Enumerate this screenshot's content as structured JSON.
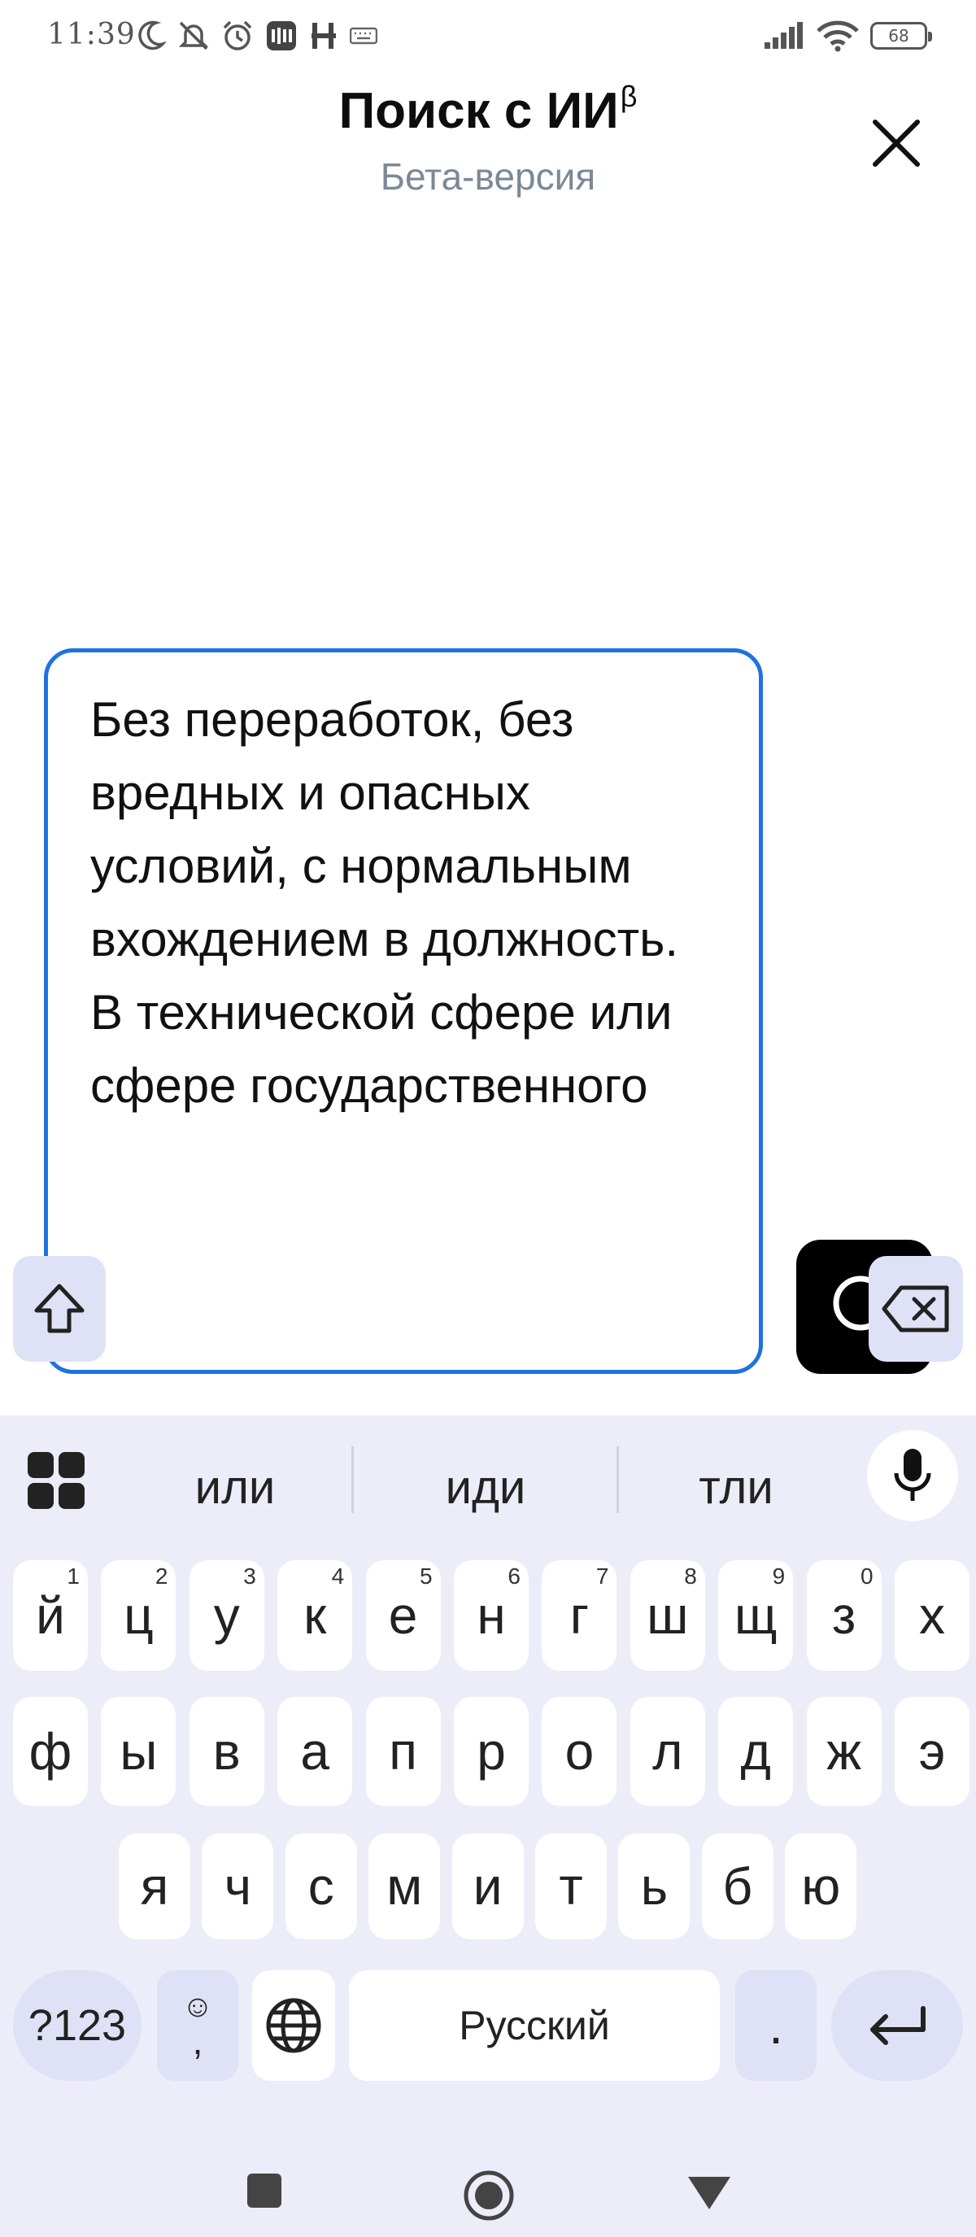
{
  "status_bar": {
    "time": "11:39",
    "battery": "68",
    "left_icons": [
      "moon-icon",
      "bell-off-icon",
      "alarm-icon",
      "app-notification-icon",
      "app-h-icon",
      "keyboard-icon"
    ],
    "right_icons": [
      "signal-icon",
      "wifi-icon",
      "battery-icon"
    ]
  },
  "header": {
    "title": "Поиск с ИИ",
    "title_superscript": "β",
    "subtitle": "Бета-версия",
    "close_icon": "close-icon"
  },
  "query": {
    "value": "Без переработок, без вредных и опасных условий, с нормальным вхождением в должность. В технической сфере или сфере государственного",
    "border_color": "#1f72e0"
  },
  "search_button": {
    "icon": "search-icon",
    "background": "#000000"
  },
  "keyboard": {
    "suggestions": [
      "или",
      "иди",
      "тли"
    ],
    "row1": [
      {
        "label": "й",
        "hint": "1"
      },
      {
        "label": "ц",
        "hint": "2"
      },
      {
        "label": "у",
        "hint": "3"
      },
      {
        "label": "к",
        "hint": "4"
      },
      {
        "label": "е",
        "hint": "5"
      },
      {
        "label": "н",
        "hint": "6"
      },
      {
        "label": "г",
        "hint": "7"
      },
      {
        "label": "ш",
        "hint": "8"
      },
      {
        "label": "щ",
        "hint": "9"
      },
      {
        "label": "з",
        "hint": "0"
      },
      {
        "label": "х",
        "hint": ""
      }
    ],
    "row2": [
      "ф",
      "ы",
      "в",
      "а",
      "п",
      "р",
      "о",
      "л",
      "д",
      "ж",
      "э"
    ],
    "row3": [
      "я",
      "ч",
      "с",
      "м",
      "и",
      "т",
      "ь",
      "б",
      "ю"
    ],
    "bottom": {
      "symbols_label": "?123",
      "emoji_top": "☺",
      "emoji_bottom": ",",
      "space_label": "Русский",
      "period_label": "."
    },
    "background": "#ecedf8",
    "special_key_color": "#dfe2f6"
  },
  "nav_bar": {
    "icons": [
      "square-nav-icon",
      "circle-nav-icon",
      "triangle-nav-icon"
    ]
  }
}
